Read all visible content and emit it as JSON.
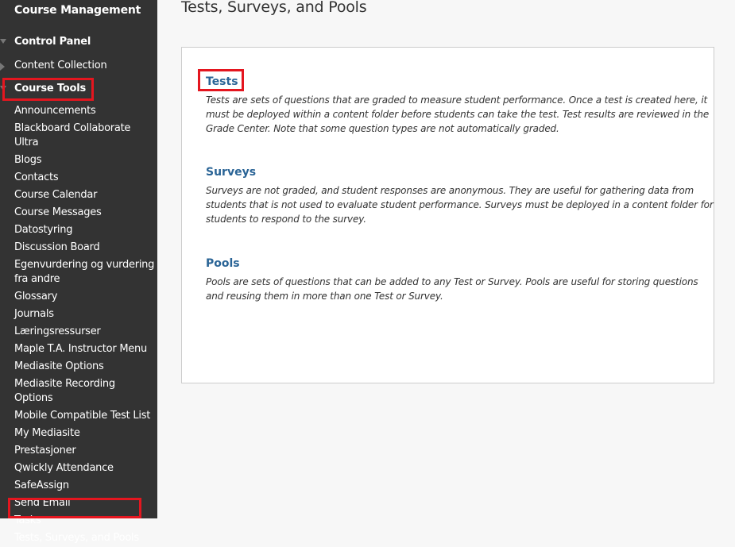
{
  "sidebar": {
    "title": "Course Management",
    "sections": [
      {
        "label": "Control Panel",
        "expanded": true
      },
      {
        "label": "Content Collection",
        "expanded": false
      },
      {
        "label": "Course Tools",
        "expanded": true
      }
    ],
    "items": [
      {
        "label": "Announcements"
      },
      {
        "label": "Blackboard Collaborate Ultra"
      },
      {
        "label": "Blogs"
      },
      {
        "label": "Contacts"
      },
      {
        "label": "Course Calendar"
      },
      {
        "label": "Course Messages"
      },
      {
        "label": "Datostyring"
      },
      {
        "label": "Discussion Board"
      },
      {
        "label": "Egenvurdering og vurdering fra andre"
      },
      {
        "label": "Glossary"
      },
      {
        "label": "Journals"
      },
      {
        "label": "Læringsressurser"
      },
      {
        "label": "Maple T.A. Instructor Menu"
      },
      {
        "label": "Mediasite Options"
      },
      {
        "label": "Mediasite Recording Options"
      },
      {
        "label": "Mobile Compatible Test List"
      },
      {
        "label": "My Mediasite"
      },
      {
        "label": "Prestasjoner"
      },
      {
        "label": "Qwickly Attendance"
      },
      {
        "label": "SafeAssign"
      },
      {
        "label": "Send Email"
      },
      {
        "label": "Tasks"
      },
      {
        "label": "Tests, Surveys, and Pools"
      }
    ]
  },
  "page": {
    "title": "Tests, Surveys, and Pools",
    "entries": [
      {
        "link": "Tests",
        "description": "Tests are sets of questions that are graded to measure student performance. Once a test is created here, it must be deployed within a content folder before students can take the test. Test results are reviewed in the Grade Center. Note that some question types are not automatically graded."
      },
      {
        "link": "Surveys",
        "description": "Surveys are not graded, and student responses are anonymous. They are useful for gathering data from students that is not used to evaluate student performance. Surveys must be deployed in a content folder for students to respond to the survey."
      },
      {
        "link": "Pools",
        "description": "Pools are sets of questions that can be added to any Test or Survey. Pools are useful for storing questions and reusing them in more than one Test or Survey."
      }
    ]
  },
  "colors": {
    "sidebar_bg": "#333333",
    "link": "#2a6496",
    "highlight": "#e4161f",
    "page_bg": "#f7f7f7"
  }
}
